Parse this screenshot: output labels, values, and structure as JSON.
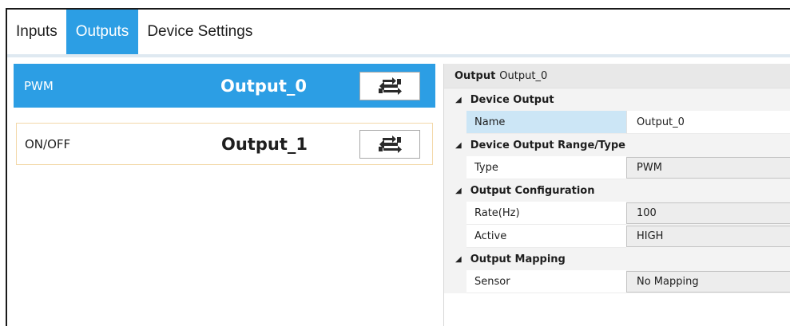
{
  "tabs": [
    {
      "label": "Inputs",
      "active": false
    },
    {
      "label": "Outputs",
      "active": true
    },
    {
      "label": "Device Settings",
      "active": false
    }
  ],
  "outputs": [
    {
      "type": "PWM",
      "name": "Output_0",
      "selected": true
    },
    {
      "type": "ON/OFF",
      "name": "Output_1",
      "selected": false
    }
  ],
  "properties": {
    "header_bold": "Output",
    "header_value": "Output_0",
    "categories": [
      {
        "title": "Device Output",
        "rows": [
          {
            "label": "Name",
            "value": "Output_0"
          }
        ]
      },
      {
        "title": "Device Output Range/Type",
        "rows": [
          {
            "label": "Type",
            "value": "PWM"
          }
        ]
      },
      {
        "title": "Output Configuration",
        "rows": [
          {
            "label": "Rate(Hz)",
            "value": "100"
          },
          {
            "label": "Active",
            "value": "HIGH"
          }
        ]
      },
      {
        "title": "Output Mapping",
        "rows": [
          {
            "label": "Sensor",
            "value": "No Mapping"
          }
        ]
      }
    ]
  },
  "icons": {
    "toggle": "swap-arrows-icon",
    "expand": "triangle-down-icon"
  },
  "colors": {
    "accent": "#2c9ee4",
    "selected_label_bg": "#cce6f6",
    "row_border": "#f3d8a8"
  }
}
